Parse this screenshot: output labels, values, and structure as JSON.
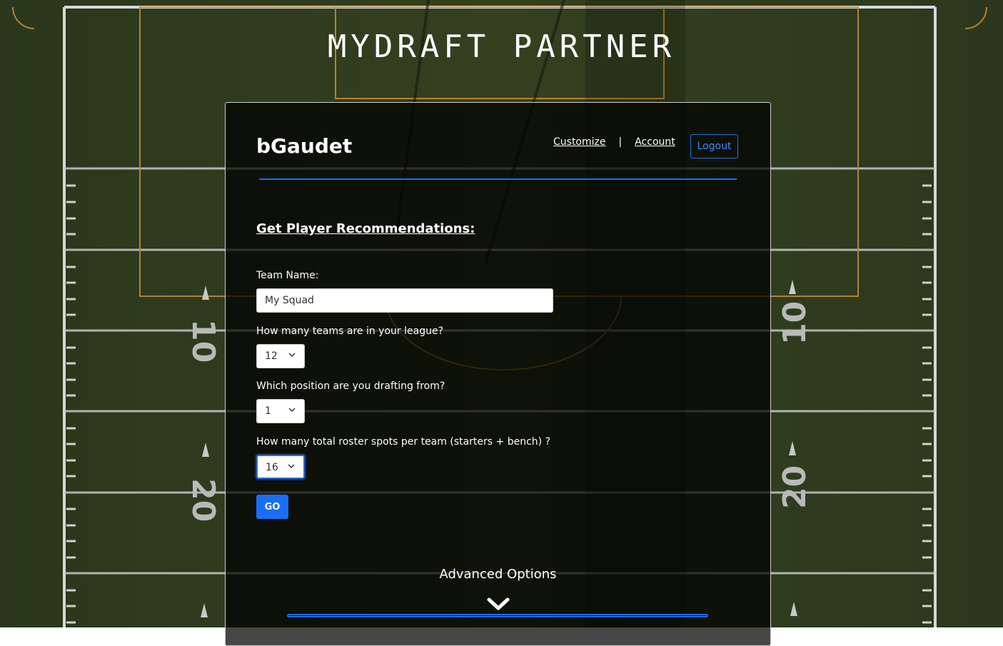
{
  "app_title": "MYDRAFT PARTNER",
  "header": {
    "username": "bGaudet",
    "nav": {
      "customize": "Customize",
      "separator": "|",
      "account": "Account",
      "logout": "Logout"
    }
  },
  "form": {
    "heading": "Get Player Recommendations:",
    "team_name_label": "Team Name:",
    "team_name_value": "My Squad",
    "teams_label": "How many teams are in your league?",
    "teams_value": "12",
    "position_label": "Which position are you drafting from?",
    "position_value": "1",
    "roster_label": "How many total roster spots per team (starters + bench) ?",
    "roster_value": "16",
    "go_label": "GO"
  },
  "advanced": {
    "label": "Advanced Options",
    "icon": "chevron-down-icon"
  },
  "field_marks": {
    "left_top": "10",
    "left_bottom": "20",
    "right_top": "10",
    "right_bottom": "20"
  },
  "colors": {
    "accent": "#1a6ef5",
    "card_bg": "rgba(0,0,0,0.72)",
    "turf": "#2d3a1f"
  }
}
